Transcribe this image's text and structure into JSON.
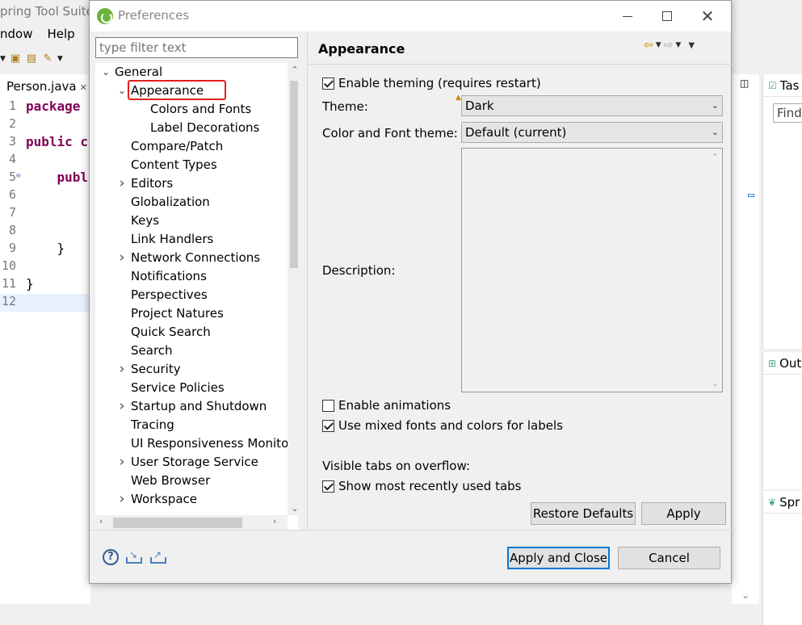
{
  "ide": {
    "title": "pring Tool Suite",
    "menu": [
      "ndow",
      "Help"
    ],
    "editor_tab": "Person.java",
    "code": [
      {
        "ln": "1",
        "text": "package"
      },
      {
        "ln": "2",
        "text": ""
      },
      {
        "ln": "3",
        "text": "public c"
      },
      {
        "ln": "4",
        "text": ""
      },
      {
        "ln": "5",
        "text": "    publ"
      },
      {
        "ln": "6",
        "text": ""
      },
      {
        "ln": "7",
        "text": ""
      },
      {
        "ln": "8",
        "text": ""
      },
      {
        "ln": "9",
        "text": "    }"
      },
      {
        "ln": "10",
        "text": ""
      },
      {
        "ln": "11",
        "text": "}"
      },
      {
        "ln": "12",
        "text": ""
      }
    ],
    "right_panels": {
      "tasks": "Tas",
      "find": "Find",
      "outline": "Out",
      "spring": "Spr"
    }
  },
  "dialog": {
    "title": "Preferences",
    "filter_placeholder": "type filter text",
    "tree": [
      {
        "label": "General",
        "level": 0,
        "expander": "expanded"
      },
      {
        "label": "Appearance",
        "level": 1,
        "expander": "expanded",
        "selected": true
      },
      {
        "label": "Colors and Fonts",
        "level": 2,
        "expander": "none"
      },
      {
        "label": "Label Decorations",
        "level": 2,
        "expander": "none"
      },
      {
        "label": "Compare/Patch",
        "level": 1,
        "expander": "none"
      },
      {
        "label": "Content Types",
        "level": 1,
        "expander": "none"
      },
      {
        "label": "Editors",
        "level": 1,
        "expander": "collapsed"
      },
      {
        "label": "Globalization",
        "level": 1,
        "expander": "none"
      },
      {
        "label": "Keys",
        "level": 1,
        "expander": "none"
      },
      {
        "label": "Link Handlers",
        "level": 1,
        "expander": "none"
      },
      {
        "label": "Network Connections",
        "level": 1,
        "expander": "collapsed"
      },
      {
        "label": "Notifications",
        "level": 1,
        "expander": "none"
      },
      {
        "label": "Perspectives",
        "level": 1,
        "expander": "none"
      },
      {
        "label": "Project Natures",
        "level": 1,
        "expander": "none"
      },
      {
        "label": "Quick Search",
        "level": 1,
        "expander": "none"
      },
      {
        "label": "Search",
        "level": 1,
        "expander": "none"
      },
      {
        "label": "Security",
        "level": 1,
        "expander": "collapsed"
      },
      {
        "label": "Service Policies",
        "level": 1,
        "expander": "none"
      },
      {
        "label": "Startup and Shutdown",
        "level": 1,
        "expander": "collapsed"
      },
      {
        "label": "Tracing",
        "level": 1,
        "expander": "none"
      },
      {
        "label": "UI Responsiveness Monito",
        "level": 1,
        "expander": "none"
      },
      {
        "label": "User Storage Service",
        "level": 1,
        "expander": "collapsed"
      },
      {
        "label": "Web Browser",
        "level": 1,
        "expander": "none"
      },
      {
        "label": "Workspace",
        "level": 1,
        "expander": "collapsed"
      }
    ],
    "page": {
      "title": "Appearance",
      "enable_theming": {
        "label": "Enable theming (requires restart)",
        "checked": true
      },
      "theme": {
        "label": "Theme:",
        "value": "Dark"
      },
      "color_font_theme": {
        "label": "Color and Font theme:",
        "value": "Default (current)"
      },
      "description_label": "Description:",
      "enable_animations": {
        "label": "Enable animations",
        "checked": false
      },
      "mixed_fonts": {
        "label": "Use mixed fonts and colors for labels",
        "checked": true
      },
      "visible_tabs_label": "Visible tabs on overflow:",
      "show_mru": {
        "label": "Show most recently used tabs",
        "checked": true
      },
      "restore_defaults": "Restore Defaults",
      "apply": "Apply"
    },
    "buttons": {
      "apply_close": "Apply and Close",
      "cancel": "Cancel"
    },
    "colors": {
      "selection_highlight": "#e02020",
      "default_button_border": "#0078d7",
      "keyword": "#7f0055"
    }
  }
}
